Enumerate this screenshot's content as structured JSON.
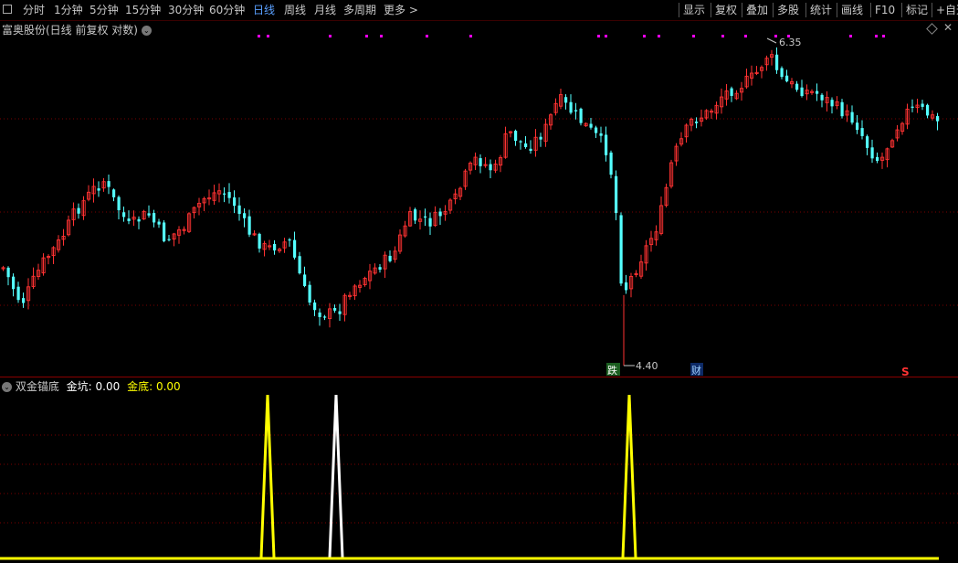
{
  "toolbar": {
    "left": [
      "分时",
      "1分钟",
      "5分钟",
      "15分钟",
      "30分钟",
      "60分钟",
      "日线",
      "周线",
      "月线",
      "多周期",
      "更多 >"
    ],
    "active": "日线",
    "right": [
      "显示",
      "复权",
      "叠加",
      "多股",
      "统计",
      "画线",
      "F10",
      "标记",
      "+自选"
    ]
  },
  "main_chart": {
    "title": "富奥股份(日线 前复权 对数)",
    "high_label": "6.35",
    "low_label": "4.40",
    "markers": {
      "die": "跌",
      "cai": "财",
      "s": "S"
    },
    "colors": {
      "up": "#ff3232",
      "down": "#54ffff",
      "dots": "#ff00ff",
      "grid": "#7a0000"
    }
  },
  "indicator": {
    "name": "双金锚底",
    "jinkeng_label": "金坑:",
    "jinkeng_value": "0.00",
    "jindi_label": "金底:",
    "jindi_value": "0.00",
    "colors": {
      "jinkeng": "#ffffff",
      "jindi": "#ffff00"
    }
  }
}
